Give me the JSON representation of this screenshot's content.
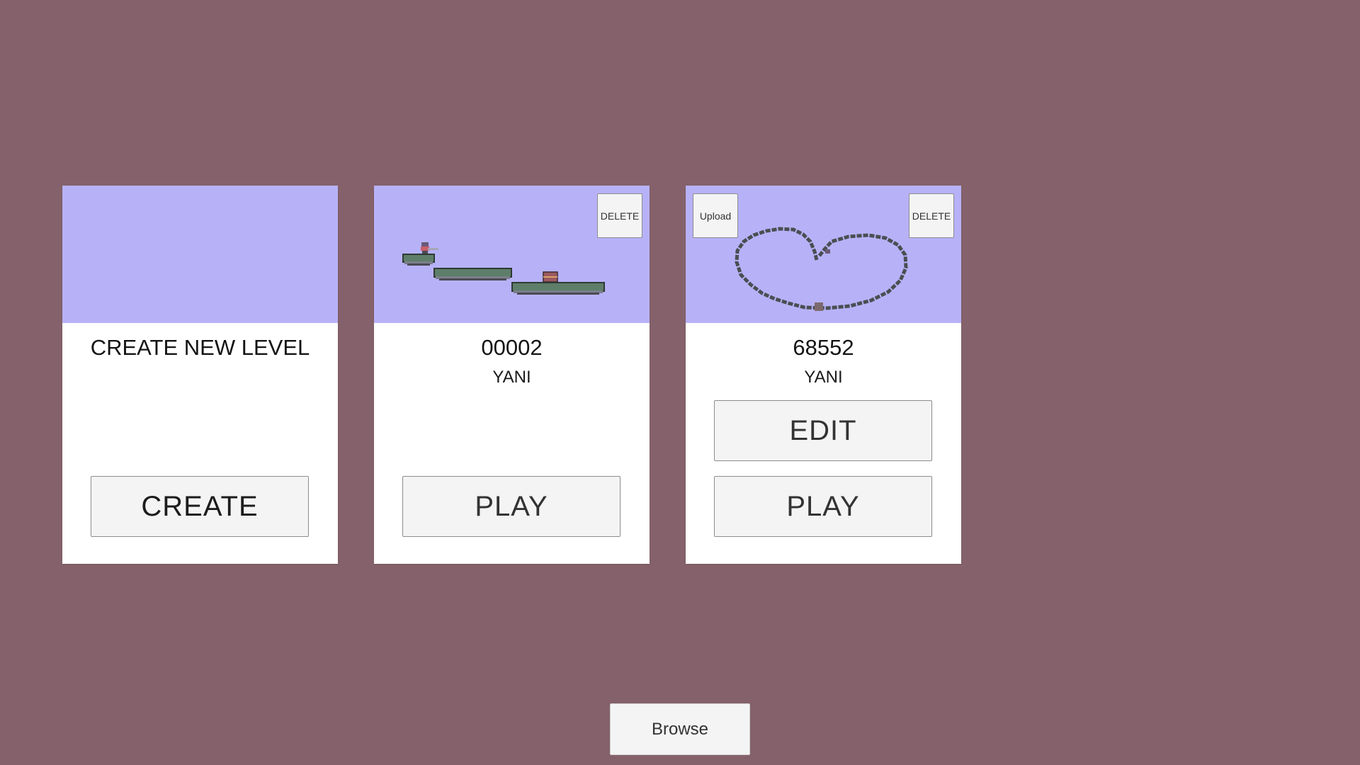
{
  "colors": {
    "background": "#85626b",
    "thumbnail": "#b7b2f8",
    "card": "#ffffff",
    "button": "#f4f4f4"
  },
  "levels": [
    {
      "title": "CREATE NEW LEVEL",
      "action_label": "CREATE"
    },
    {
      "title": "00002",
      "author": "YANI",
      "delete_label": "DELETE",
      "play_label": "PLAY"
    },
    {
      "title": "68552",
      "author": "YANI",
      "upload_label": "Upload",
      "delete_label": "DELETE",
      "edit_label": "EDIT",
      "play_label": "PLAY"
    }
  ],
  "footer": {
    "browse_label": "Browse"
  }
}
